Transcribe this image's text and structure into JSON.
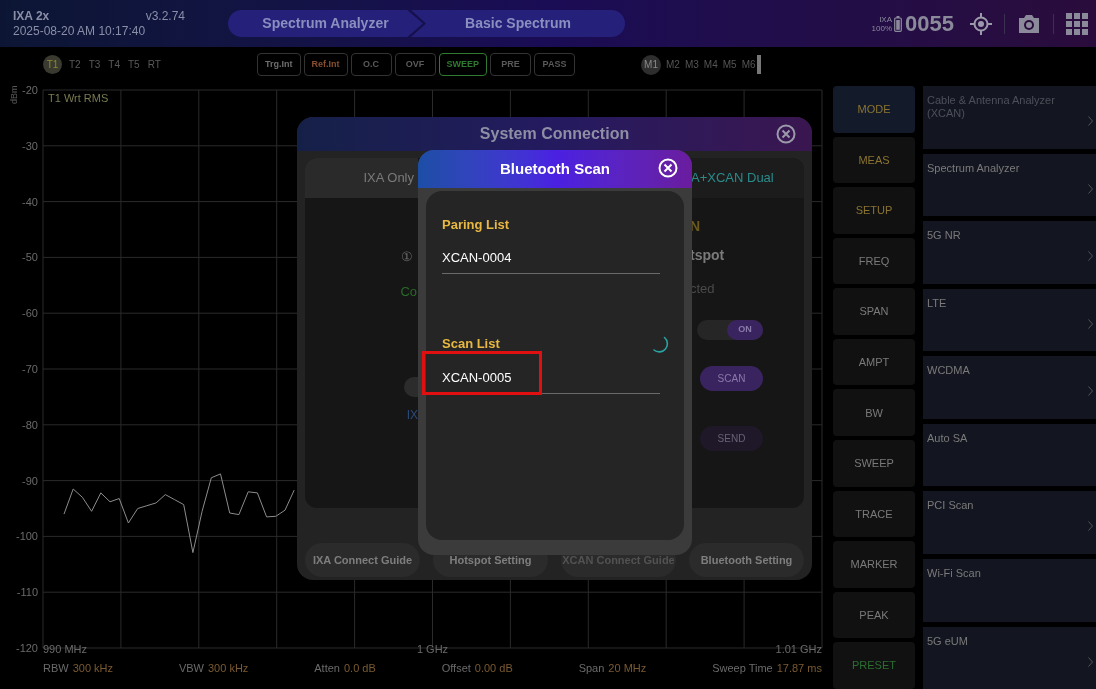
{
  "top_bar": {
    "model": "IXA 2x",
    "version": "v3.2.74",
    "datetime": "2025-08-20 AM 10:17:40",
    "breadcrumb": [
      "Spectrum Analyzer",
      "Basic Spectrum"
    ],
    "battery": {
      "device": "IXA",
      "percent": "100%"
    },
    "counter": "0055"
  },
  "traces": [
    {
      "label": "T1",
      "selected": true
    },
    {
      "label": "T2",
      "selected": false
    },
    {
      "label": "T3",
      "selected": false
    },
    {
      "label": "T4",
      "selected": false
    },
    {
      "label": "T5",
      "selected": false
    },
    {
      "label": "RT",
      "selected": false
    }
  ],
  "indicators": [
    {
      "label": "Trg.Int",
      "color": "#6e6e6e"
    },
    {
      "label": "Ref.Int",
      "color": "#8a4f2e"
    },
    {
      "label": "O.C",
      "color": "#5a5a5a"
    },
    {
      "label": "OVF",
      "color": "#5a5a5a"
    },
    {
      "label": "SWEEP",
      "color": "#2f7a2f"
    },
    {
      "label": "PRE",
      "color": "#5a5a5a"
    },
    {
      "label": "PASS",
      "color": "#5a5a5a"
    }
  ],
  "markers": [
    {
      "label": "M1",
      "selected": true
    },
    {
      "label": "M2",
      "selected": false
    },
    {
      "label": "M3",
      "selected": false
    },
    {
      "label": "M4",
      "selected": false
    },
    {
      "label": "M5",
      "selected": false
    },
    {
      "label": "M6",
      "selected": false
    }
  ],
  "chart": {
    "chart_data": {
      "type": "line",
      "ylabel": "dBm",
      "grid": true,
      "ylim": [
        -120,
        -20
      ],
      "yticks": [
        -20,
        -30,
        -40,
        -50,
        -60,
        -70,
        -80,
        -90,
        -100,
        -110,
        -120
      ],
      "categories": [
        "990 MHz",
        null,
        null,
        null,
        null,
        null,
        null,
        null,
        null,
        null,
        null,
        null,
        null,
        null,
        null,
        null,
        null,
        null,
        null,
        null,
        null,
        null,
        null,
        null,
        null,
        null,
        null,
        null,
        null,
        null,
        null,
        null,
        null,
        null,
        null,
        null,
        null,
        null,
        null,
        null,
        "1 GHz",
        null,
        null,
        null,
        null,
        null,
        null,
        null,
        null,
        null,
        null,
        null,
        null,
        null,
        null,
        null,
        null,
        null,
        null,
        null,
        null,
        null,
        null,
        null,
        null,
        null,
        null,
        null,
        null,
        null,
        null,
        null,
        null,
        null,
        null,
        null,
        null,
        null,
        null,
        null,
        "1.01 GHz"
      ],
      "series": [
        {
          "name": "T1 Wrt RMS",
          "color": "#8c8c8c",
          "values": [
            -96,
            -91.5,
            -93,
            -95.5,
            -92.2,
            -93.8,
            -93.2,
            -97.6,
            -95,
            -94.5,
            -94,
            -92.5,
            -93.4,
            -94.3,
            -102.9,
            -95.5,
            -89.5,
            -88.8,
            -95.8,
            -96.1,
            -92,
            -92.2,
            -96.5,
            -96.4,
            -95.3,
            -91.7,
            null,
            null,
            null,
            null,
            null,
            null,
            null,
            null,
            null,
            null,
            null,
            null,
            null,
            null,
            null,
            null,
            null,
            null,
            null,
            null,
            null,
            null,
            null,
            null,
            null,
            null,
            null,
            null,
            null,
            null,
            null,
            null,
            null,
            null,
            null,
            null,
            null,
            null,
            null,
            null,
            null,
            null,
            null,
            null,
            null,
            null,
            null,
            null,
            null,
            null,
            null,
            null,
            null,
            null,
            null
          ]
        }
      ]
    }
  },
  "parameters": [
    {
      "label": "RBW",
      "value": "300 kHz"
    },
    {
      "label": "VBW",
      "value": "300 kHz"
    },
    {
      "label": "Atten",
      "value": "0.0 dB"
    },
    {
      "label": "Offset",
      "value": "0.00 dB"
    },
    {
      "label": "Span",
      "value": "20 MHz"
    },
    {
      "label": "Sweep Time",
      "value": "17.87 ms"
    }
  ],
  "softkeys": [
    {
      "label": "MODE",
      "color": "#8a7430",
      "selected": true
    },
    {
      "label": "MEAS",
      "color": "#8a7430",
      "selected": false
    },
    {
      "label": "SETUP",
      "color": "#8a7430",
      "selected": false
    },
    {
      "label": "FREQ",
      "color": "#7a7a7a",
      "selected": false
    },
    {
      "label": "SPAN",
      "color": "#7a7a7a",
      "selected": false
    },
    {
      "label": "AMPT",
      "color": "#7a7a7a",
      "selected": false
    },
    {
      "label": "BW",
      "color": "#7a7a7a",
      "selected": false
    },
    {
      "label": "SWEEP",
      "color": "#7a7a7a",
      "selected": false
    },
    {
      "label": "TRACE",
      "color": "#7a7a7a",
      "selected": false
    },
    {
      "label": "MARKER",
      "color": "#7a7a7a",
      "selected": false
    },
    {
      "label": "PEAK",
      "color": "#7a7a7a",
      "selected": false
    },
    {
      "label": "PRESET",
      "color": "#2c6e32",
      "selected": false
    }
  ],
  "menu": [
    {
      "label": "Cable & Antenna Analyzer (XCAN)",
      "disabled": true,
      "submenu": true
    },
    {
      "label": "Spectrum Analyzer",
      "disabled": false,
      "submenu": true
    },
    {
      "label": "5G NR",
      "disabled": false,
      "submenu": true
    },
    {
      "label": "LTE",
      "disabled": false,
      "submenu": true
    },
    {
      "label": "WCDMA",
      "disabled": false,
      "submenu": true
    },
    {
      "label": "Auto SA",
      "disabled": false,
      "submenu": false
    },
    {
      "label": "PCI Scan",
      "disabled": false,
      "submenu": true
    },
    {
      "label": "Wi-Fi Scan",
      "disabled": false,
      "submenu": false
    },
    {
      "label": "5G eUM",
      "disabled": false,
      "submenu": true
    }
  ],
  "system_connection": {
    "title": "System Connection",
    "tabs": [
      {
        "label": "IXA Only",
        "selected": false
      },
      {
        "label": "A+XCAN Dual",
        "selected": true
      }
    ],
    "left": [
      {
        "kind": "step",
        "text": "①"
      },
      {
        "kind": "status",
        "text": "Co"
      },
      {
        "kind": "toggle",
        "on": false
      },
      {
        "kind": "link",
        "text": "IX"
      }
    ],
    "right": [
      {
        "kind": "heading",
        "text": "N"
      },
      {
        "kind": "title",
        "text": "tspot"
      },
      {
        "kind": "status",
        "text": "cted"
      },
      {
        "kind": "toggle",
        "text": "ON",
        "on": true
      },
      {
        "kind": "button",
        "text": "SCAN",
        "disabled": false
      },
      {
        "kind": "button",
        "text": "SEND",
        "disabled": true
      }
    ],
    "buttons": [
      {
        "label": "IXA Connect Guide",
        "disabled": false
      },
      {
        "label": "Hotspot Setting",
        "disabled": false
      },
      {
        "label": "XCAN Connect Guide",
        "disabled": true
      },
      {
        "label": "Bluetooth Setting",
        "disabled": false
      }
    ]
  },
  "bluetooth_scan": {
    "title": "Bluetooth Scan",
    "pairing": {
      "heading": "Paring List",
      "devices": [
        {
          "name": "XCAN-0004",
          "highlighted": false
        }
      ]
    },
    "scan": {
      "heading": "Scan List",
      "scanning": true,
      "devices": [
        {
          "name": "XCAN-0005",
          "highlighted": true
        }
      ]
    }
  }
}
